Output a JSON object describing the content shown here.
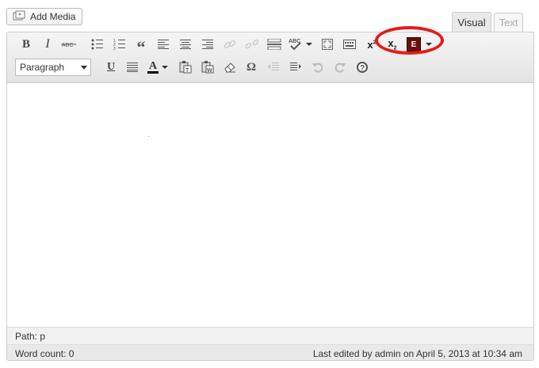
{
  "add_media": {
    "label": "Add Media",
    "icon": "media-upload-icon"
  },
  "tabs": {
    "visual": "Visual",
    "text": "Text"
  },
  "toolbar": {
    "format_select": "Paragraph",
    "row1_icons": [
      "bold-icon",
      "italic-icon",
      "strikethrough-icon",
      "bullet-list-icon",
      "numbered-list-icon",
      "blockquote-icon",
      "align-left-icon",
      "align-center-icon",
      "align-right-icon",
      "insert-link-icon",
      "unlink-icon",
      "read-more-icon",
      "spellcheck-icon",
      "fullscreen-icon",
      "kitchen-sink-icon",
      "superscript-icon",
      "subscript-icon",
      "plugin-e-icon"
    ],
    "row2_icons": [
      "underline-icon",
      "justify-icon",
      "text-color-icon",
      "paste-text-icon",
      "paste-word-icon",
      "clear-formatting-icon",
      "special-char-icon",
      "outdent-icon",
      "indent-icon",
      "undo-icon",
      "redo-icon",
      "help-icon"
    ],
    "highlight_color": "#e41b17"
  },
  "path": {
    "label": "Path: p"
  },
  "status": {
    "word_count": "Word count: 0",
    "last_edited": "Last edited by admin on April 5, 2013 at 10:34 am"
  }
}
